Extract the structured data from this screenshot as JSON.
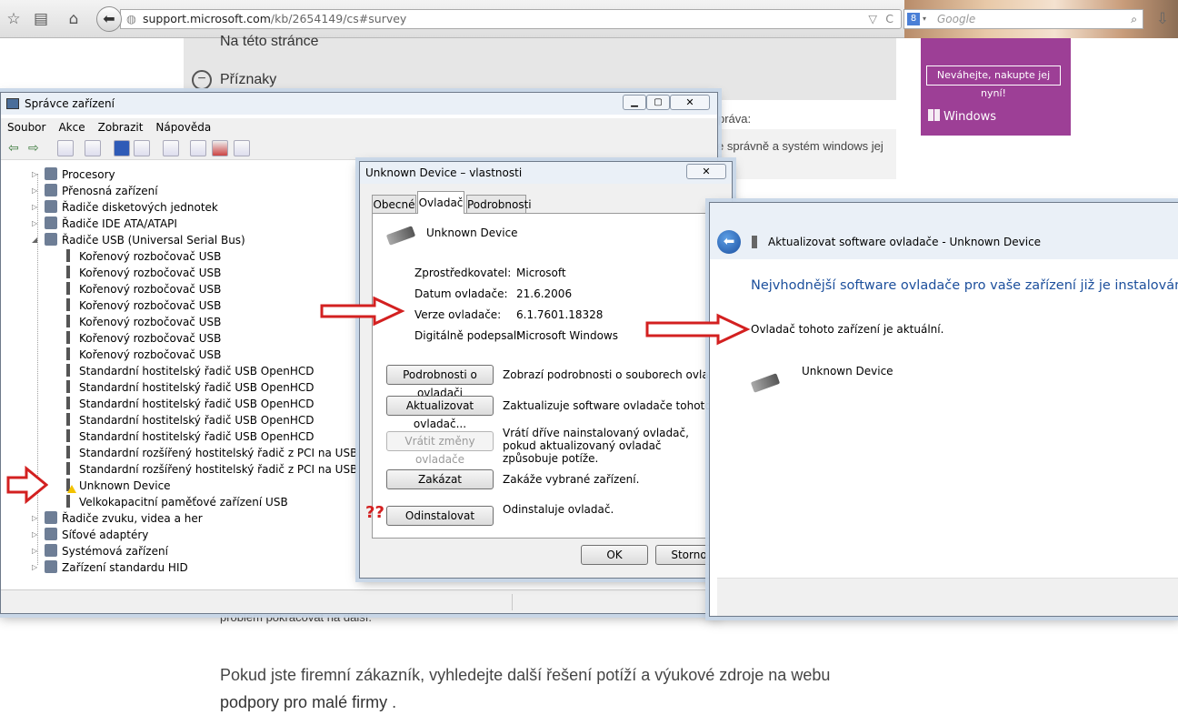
{
  "browser": {
    "url_host": "support.microsoft.com",
    "url_path": "/kb/2654149/cs#survey",
    "search_placeholder": "Google"
  },
  "page": {
    "section_on_page": "Na této stránce",
    "section_symptoms": "Příznaky",
    "snippet_1": "práva:",
    "snippet_2": "e správně a systém windows jej",
    "snippet_3": "problém pokračovat na další.",
    "business_text": "Pokud jste firemní zákazník, vyhledejte další řešení potíží a výukové zdroje na webu",
    "business_link": "podpory pro malé firmy",
    "business_end": " .",
    "promo_button": "Neváhejte, nakupte jej nyní!",
    "promo_brand": "Windows"
  },
  "device_manager": {
    "title": "Správce zařízení",
    "menu": [
      "Soubor",
      "Akce",
      "Zobrazit",
      "Nápověda"
    ],
    "tree": [
      {
        "label": "Procesory",
        "level": 1
      },
      {
        "label": "Přenosná zařízení",
        "level": 1
      },
      {
        "label": "Řadiče disketových jednotek",
        "level": 1
      },
      {
        "label": "Řadiče IDE ATA/ATAPI",
        "level": 1
      },
      {
        "label": "Řadiče USB (Universal Serial Bus)",
        "level": 1
      },
      {
        "label": "Kořenový rozbočovač USB",
        "level": 2
      },
      {
        "label": "Kořenový rozbočovač USB",
        "level": 2
      },
      {
        "label": "Kořenový rozbočovač USB",
        "level": 2
      },
      {
        "label": "Kořenový rozbočovač USB",
        "level": 2
      },
      {
        "label": "Kořenový rozbočovač USB",
        "level": 2
      },
      {
        "label": "Kořenový rozbočovač USB",
        "level": 2
      },
      {
        "label": "Kořenový rozbočovač USB",
        "level": 2
      },
      {
        "label": "Standardní hostitelský řadič USB OpenHCD",
        "level": 2
      },
      {
        "label": "Standardní hostitelský řadič USB OpenHCD",
        "level": 2
      },
      {
        "label": "Standardní hostitelský řadič USB OpenHCD",
        "level": 2
      },
      {
        "label": "Standardní hostitelský řadič USB OpenHCD",
        "level": 2
      },
      {
        "label": "Standardní hostitelský řadič USB OpenHCD",
        "level": 2
      },
      {
        "label": "Standardní rozšířený hostitelský řadič z PCI na USB",
        "level": 2
      },
      {
        "label": "Standardní rozšířený hostitelský řadič z PCI na USB",
        "level": 2
      },
      {
        "label": "Unknown Device",
        "level": 2
      },
      {
        "label": "Velkokapacitní paměťové zařízení USB",
        "level": 2
      },
      {
        "label": "Řadiče zvuku, videa a her",
        "level": 1
      },
      {
        "label": "Síťové adaptéry",
        "level": 1
      },
      {
        "label": "Systémová zařízení",
        "level": 1
      },
      {
        "label": "Zařízení standardu HID",
        "level": 1
      }
    ]
  },
  "properties": {
    "title": "Unknown Device – vlastnosti",
    "tabs": [
      "Obecné",
      "Ovladač",
      "Podrobnosti"
    ],
    "device_name": "Unknown Device",
    "fields": [
      {
        "label": "Zprostředkovatel:",
        "value": "Microsoft"
      },
      {
        "label": "Datum ovladače:",
        "value": "21.6.2006"
      },
      {
        "label": "Verze ovladače:",
        "value": "6.1.7601.18328"
      },
      {
        "label": "Digitálně podepsal:",
        "value": "Microsoft Windows"
      }
    ],
    "actions": [
      {
        "button": "Podrobnosti o ovladači",
        "desc": "Zobrazí podrobnosti o souborech ovladače."
      },
      {
        "button": "Aktualizovat ovladač...",
        "desc": "Zaktualizuje software ovladače tohoto zařízení."
      },
      {
        "button": "Vrátit změny ovladače",
        "desc": "Vrátí dříve nainstalovaný ovladač, pokud aktualizovaný ovladač způsobuje potíže."
      },
      {
        "button": "Zakázat",
        "desc": "Zakáže vybrané zařízení."
      },
      {
        "button": "Odinstalovat",
        "desc": "Odinstaluje ovladač."
      }
    ],
    "ok": "OK",
    "cancel": "Storno",
    "question_marks": "??"
  },
  "update_wizard": {
    "title": "Aktualizovat software ovladače - Unknown Device",
    "heading": "Nejvhodnější software ovladače pro vaše zařízení již je instalován.",
    "message": "Ovladač tohoto zařízení je aktuální.",
    "device_name": "Unknown Device"
  },
  "colors": {
    "annotation_arrow": "#d32020",
    "promo": "#9d3f96",
    "wizard_heading": "#1c4f9c"
  }
}
